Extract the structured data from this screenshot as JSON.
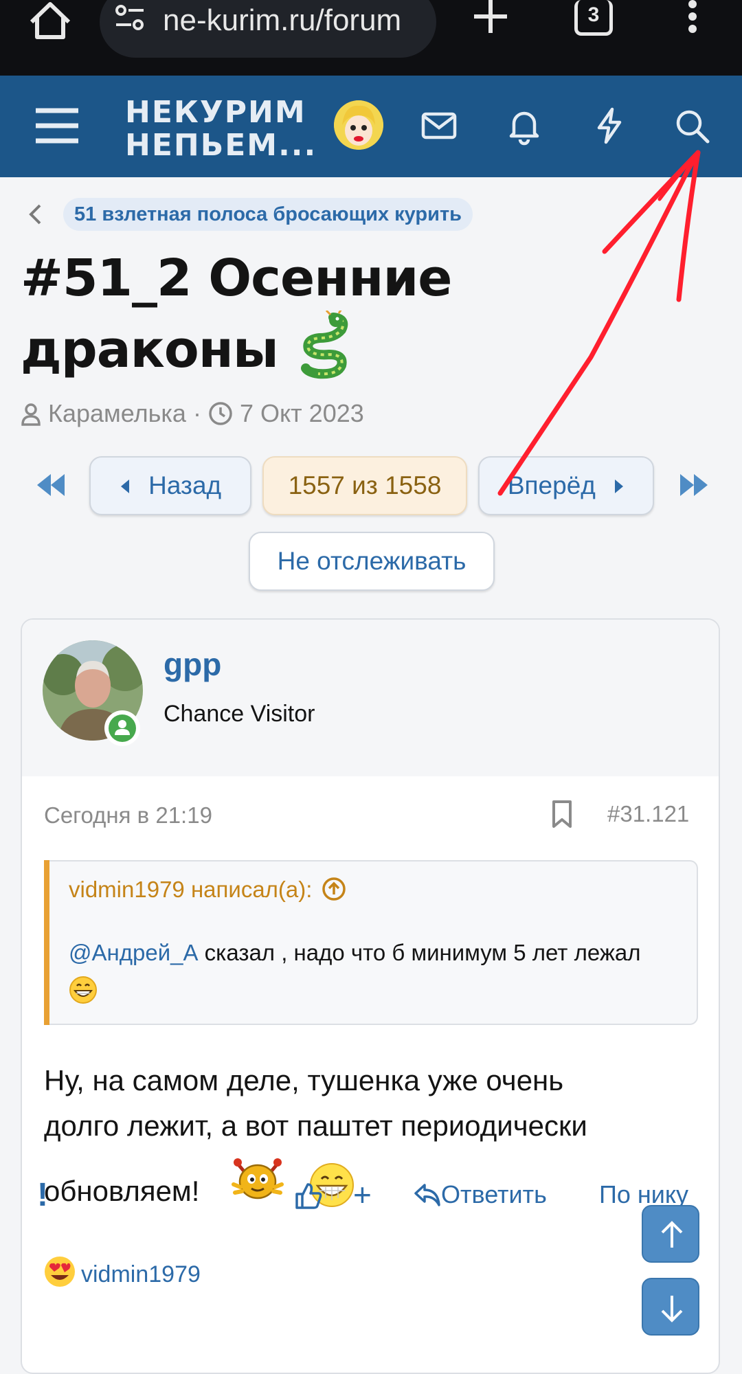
{
  "browser": {
    "url": "ne-kurim.ru/forum",
    "tab_count": "3"
  },
  "header": {
    "logo_line1": "НЕКУРИМ",
    "logo_line2": "НЕПЬЕМ..."
  },
  "breadcrumb": {
    "label": "51 взлетная полоса бросающих курить"
  },
  "thread": {
    "title": "#51_2 Осенние драконы",
    "author": "Карамелька",
    "separator": "·",
    "date": "7 Окт 2023"
  },
  "pager": {
    "prev_label": "Назад",
    "current_label": "1557 из 1558",
    "next_label": "Вперёд",
    "unwatch_label": "Не отслеживать"
  },
  "post": {
    "username": "gpp",
    "user_title": "Chance Visitor",
    "time": "Сегодня в 21:19",
    "number": "#31.121",
    "quote": {
      "author_line": "vidmin1979 написал(а):",
      "mention": "@Андрей_А",
      "text": " сказал , надо что б минимум 5 лет лежал"
    },
    "body_line1": "Ну, на самом деле, тушенка уже очень",
    "body_line2": "долго лежит, а вот паштет периодически",
    "body_line3": "обновляем!",
    "actions": {
      "report": "!",
      "plus": "+",
      "reply": "Ответить",
      "by_nick": "По нику"
    },
    "reaction_user": "vidmin1979"
  },
  "colors": {
    "header_bg": "#1c5689",
    "link": "#2c6aa8",
    "quote_accent": "#e8a033",
    "annotation": "#ff1f2e"
  }
}
